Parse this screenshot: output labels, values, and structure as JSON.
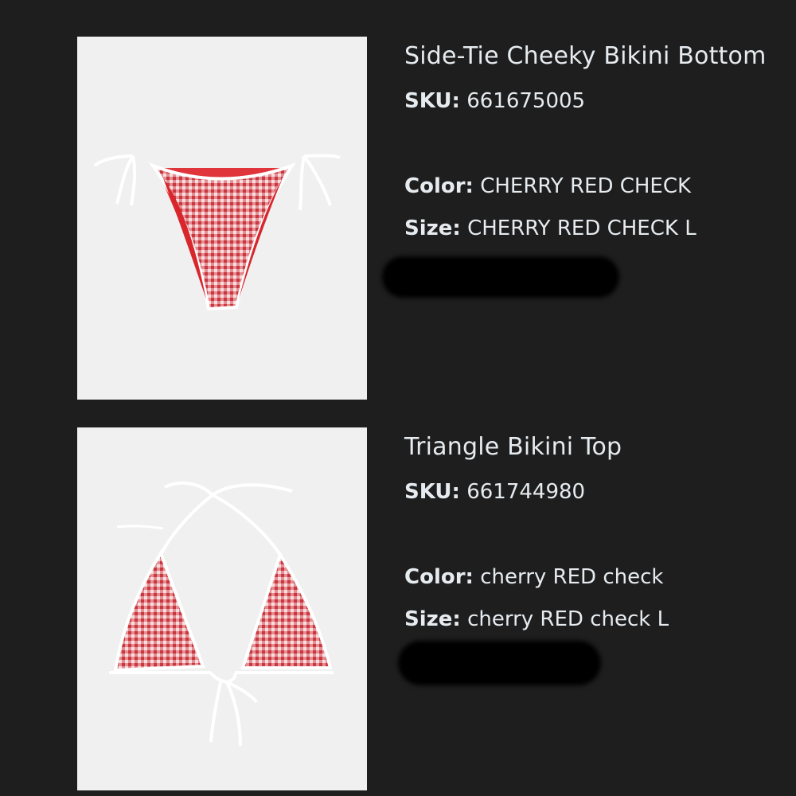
{
  "items": [
    {
      "title": "Side-Tie Cheeky Bikini Bottom",
      "sku_label": "SKU:",
      "sku": "661675005",
      "color_label": "Color:",
      "color": "CHERRY RED CHECK",
      "size_label": "Size:",
      "size": "CHERRY RED CHECK L"
    },
    {
      "title": "Triangle Bikini Top",
      "sku_label": "SKU:",
      "sku": "661744980",
      "color_label": "Color:",
      "color": "cherry RED check",
      "size_label": "Size:",
      "size": "cherry RED check L"
    }
  ],
  "colors": {
    "background": "#1e1e1e",
    "text": "#e6ebef",
    "image_bg": "#f0f0f0",
    "fabric_red": "#e0353b",
    "trim_white": "#ffffff"
  }
}
